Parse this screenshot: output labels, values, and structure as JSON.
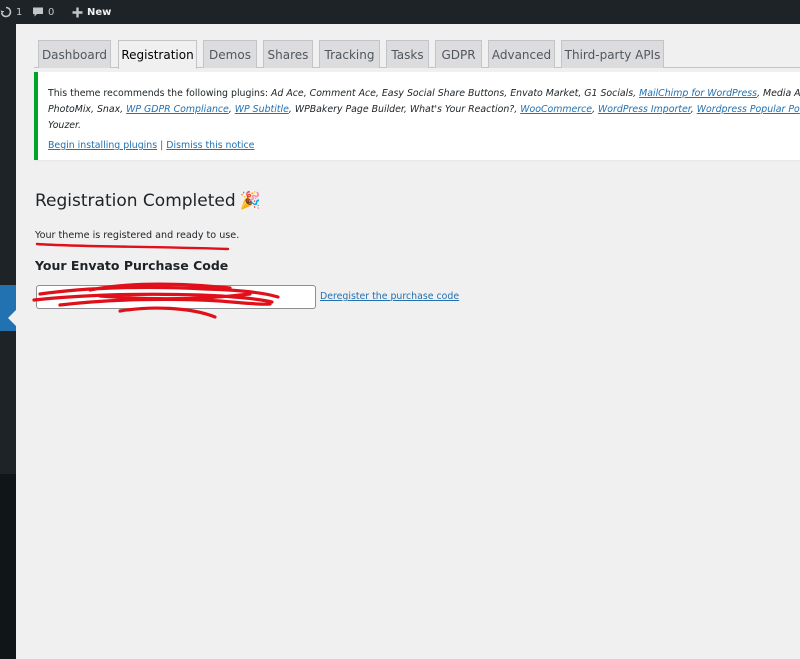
{
  "adminbar": {
    "updates_count": "1",
    "comments_count": "0",
    "new_label": "New"
  },
  "tabs": [
    {
      "label": "Dashboard"
    },
    {
      "label": "Registration"
    },
    {
      "label": "Demos"
    },
    {
      "label": "Shares"
    },
    {
      "label": "Tracking"
    },
    {
      "label": "Tasks"
    },
    {
      "label": "GDPR"
    },
    {
      "label": "Advanced"
    },
    {
      "label": "Third-party APIs"
    }
  ],
  "active_tab": "Registration",
  "notice": {
    "intro": "This theme recommends the following plugins: ",
    "line1_plain": "Ad Ace, Comment Ace, Easy Social Share Buttons, Envato Market, G1 Socials, ",
    "line1_link1": "MailChimp for WordPress",
    "line1_tail": ", Media Ace",
    "line2_head": "PhotoMix, Snax, ",
    "line2_link1": "WP GDPR Compliance",
    "line2_sep1": ", ",
    "line2_link2": "WP Subtitle",
    "line2_mid": ", WPBakery Page Builder, What's Your Reaction?, ",
    "line2_link3": "WooCommerce",
    "line2_sep2": ", ",
    "line2_link4": "WordPress Importer",
    "line2_sep3": ", ",
    "line2_link5": "Wordpress Popular Po",
    "line3": "Youzer.",
    "action_install": "Begin installing plugins",
    "action_sep": "|",
    "action_dismiss": "Dismiss this notice"
  },
  "registration": {
    "title": "Registration Completed",
    "title_emoji": "🎉",
    "status": "Your theme is registered and ready to use.",
    "code_heading": "Your Envato Purchase Code",
    "code_value": "",
    "deregister_label": "Deregister the purchase code"
  },
  "colors": {
    "adminbar_bg": "#1d2327",
    "notice_border": "#00a32a",
    "link": "#2271b1",
    "annotation_red": "#e0101a"
  }
}
